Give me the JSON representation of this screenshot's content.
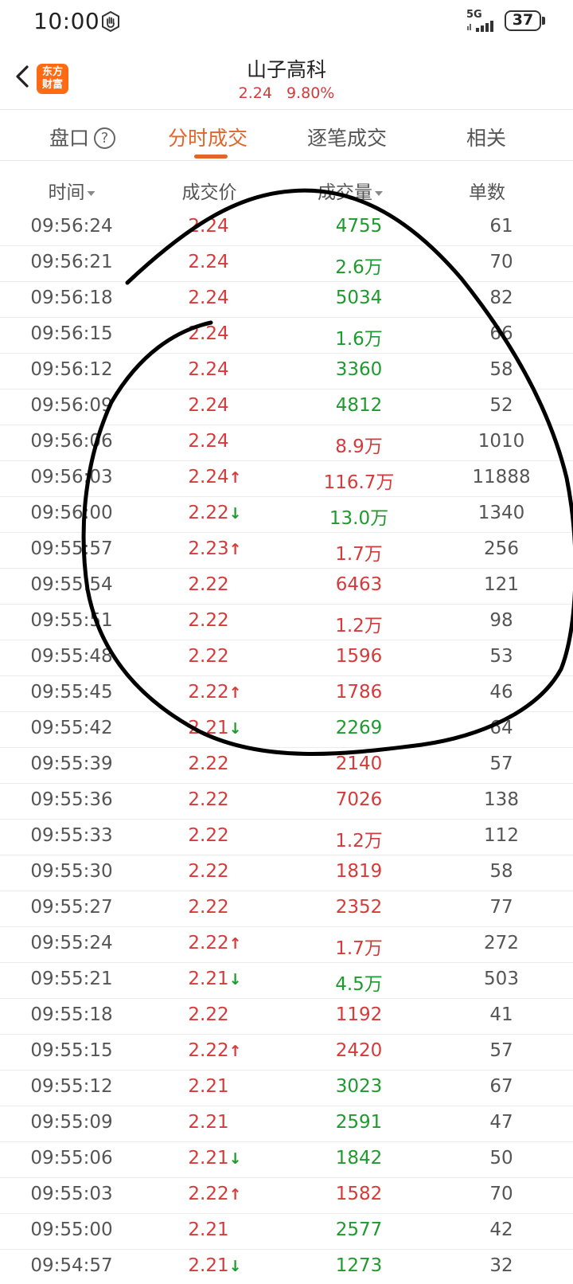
{
  "status_bar": {
    "time": "10:00",
    "network": "5G",
    "battery": "37"
  },
  "header": {
    "title": "山子高科",
    "price": "2.24",
    "change_pct": "9.80%",
    "logo_line1": "东方",
    "logo_line2": "财富"
  },
  "tabs": [
    {
      "label": "盘口",
      "active": false
    },
    {
      "label": "分时成交",
      "active": true
    },
    {
      "label": "逐笔成交",
      "active": false
    },
    {
      "label": "相关",
      "active": false
    }
  ],
  "columns": {
    "time": "时间",
    "price": "成交价",
    "volume": "成交量",
    "count": "单数"
  },
  "rows": [
    {
      "time": "09:56:24",
      "price": "2.24",
      "arrow": "",
      "volume": "4755",
      "vol_color": "green",
      "count": "61"
    },
    {
      "time": "09:56:21",
      "price": "2.24",
      "arrow": "",
      "volume": "2.6万",
      "vol_color": "green",
      "count": "70"
    },
    {
      "time": "09:56:18",
      "price": "2.24",
      "arrow": "",
      "volume": "5034",
      "vol_color": "green",
      "count": "82"
    },
    {
      "time": "09:56:15",
      "price": "2.24",
      "arrow": "",
      "volume": "1.6万",
      "vol_color": "green",
      "count": "66"
    },
    {
      "time": "09:56:12",
      "price": "2.24",
      "arrow": "",
      "volume": "3360",
      "vol_color": "green",
      "count": "58"
    },
    {
      "time": "09:56:09",
      "price": "2.24",
      "arrow": "",
      "volume": "4812",
      "vol_color": "green",
      "count": "52"
    },
    {
      "time": "09:56:06",
      "price": "2.24",
      "arrow": "",
      "volume": "8.9万",
      "vol_color": "red",
      "count": "1010"
    },
    {
      "time": "09:56:03",
      "price": "2.24",
      "arrow": "up",
      "volume": "116.7万",
      "vol_color": "red",
      "count": "11888"
    },
    {
      "time": "09:56:00",
      "price": "2.22",
      "arrow": "down",
      "volume": "13.0万",
      "vol_color": "green",
      "count": "1340"
    },
    {
      "time": "09:55:57",
      "price": "2.23",
      "arrow": "up",
      "volume": "1.7万",
      "vol_color": "red",
      "count": "256"
    },
    {
      "time": "09:55:54",
      "price": "2.22",
      "arrow": "",
      "volume": "6463",
      "vol_color": "red",
      "count": "121"
    },
    {
      "time": "09:55:51",
      "price": "2.22",
      "arrow": "",
      "volume": "1.2万",
      "vol_color": "red",
      "count": "98"
    },
    {
      "time": "09:55:48",
      "price": "2.22",
      "arrow": "",
      "volume": "1596",
      "vol_color": "red",
      "count": "53"
    },
    {
      "time": "09:55:45",
      "price": "2.22",
      "arrow": "up",
      "volume": "1786",
      "vol_color": "red",
      "count": "46"
    },
    {
      "time": "09:55:42",
      "price": "2.21",
      "arrow": "down",
      "volume": "2269",
      "vol_color": "green",
      "count": "64"
    },
    {
      "time": "09:55:39",
      "price": "2.22",
      "arrow": "",
      "volume": "2140",
      "vol_color": "red",
      "count": "57"
    },
    {
      "time": "09:55:36",
      "price": "2.22",
      "arrow": "",
      "volume": "7026",
      "vol_color": "red",
      "count": "138"
    },
    {
      "time": "09:55:33",
      "price": "2.22",
      "arrow": "",
      "volume": "1.2万",
      "vol_color": "red",
      "count": "112"
    },
    {
      "time": "09:55:30",
      "price": "2.22",
      "arrow": "",
      "volume": "1819",
      "vol_color": "red",
      "count": "58"
    },
    {
      "time": "09:55:27",
      "price": "2.22",
      "arrow": "",
      "volume": "2352",
      "vol_color": "red",
      "count": "77"
    },
    {
      "time": "09:55:24",
      "price": "2.22",
      "arrow": "up",
      "volume": "1.7万",
      "vol_color": "red",
      "count": "272"
    },
    {
      "time": "09:55:21",
      "price": "2.21",
      "arrow": "down",
      "volume": "4.5万",
      "vol_color": "green",
      "count": "503"
    },
    {
      "time": "09:55:18",
      "price": "2.22",
      "arrow": "",
      "volume": "1192",
      "vol_color": "red",
      "count": "41"
    },
    {
      "time": "09:55:15",
      "price": "2.22",
      "arrow": "up",
      "volume": "2420",
      "vol_color": "red",
      "count": "57"
    },
    {
      "time": "09:55:12",
      "price": "2.21",
      "arrow": "",
      "volume": "3023",
      "vol_color": "green",
      "count": "67"
    },
    {
      "time": "09:55:09",
      "price": "2.21",
      "arrow": "",
      "volume": "2591",
      "vol_color": "green",
      "count": "47"
    },
    {
      "time": "09:55:06",
      "price": "2.21",
      "arrow": "down",
      "volume": "1842",
      "vol_color": "green",
      "count": "50"
    },
    {
      "time": "09:55:03",
      "price": "2.22",
      "arrow": "up",
      "volume": "1582",
      "vol_color": "red",
      "count": "70"
    },
    {
      "time": "09:55:00",
      "price": "2.21",
      "arrow": "",
      "volume": "2577",
      "vol_color": "green",
      "count": "42"
    },
    {
      "time": "09:54:57",
      "price": "2.21",
      "arrow": "down",
      "volume": "1273",
      "vol_color": "green",
      "count": "32"
    }
  ],
  "colors": {
    "up": "#d63a3a",
    "down": "#1e9a2e",
    "accent": "#e0662b",
    "logo": "#ff6a13"
  }
}
